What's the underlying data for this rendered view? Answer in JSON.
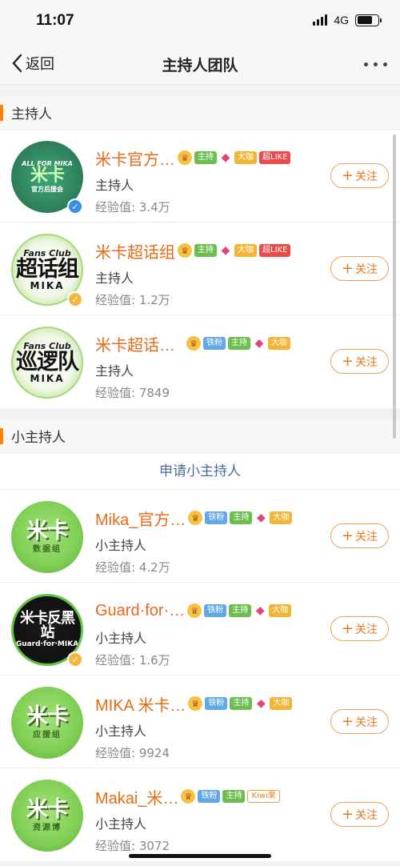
{
  "status": {
    "time": "11:07",
    "network": "4G"
  },
  "nav": {
    "back_label": "返回",
    "title": "主持人团队"
  },
  "sections": {
    "hosts_title": "主持人",
    "sub_hosts_title": "小主持人",
    "apply_label": "申请小主持人"
  },
  "follow_label": "关注",
  "hosts": [
    {
      "name": "米卡官方…",
      "role": "主持人",
      "exp": "经验值: 3.4万",
      "avatar": {
        "line1": "ALL FOR MIKA",
        "line2": "米卡",
        "line3": "官方后援会"
      },
      "tags": [
        "主持",
        "大咖",
        "超LIKE"
      ]
    },
    {
      "name": "米卡超话组",
      "role": "主持人",
      "exp": "经验值: 1.2万",
      "avatar": {
        "line1": "Fans Club",
        "line2": "超话组",
        "line3": "MIKA"
      },
      "tags": [
        "主持",
        "大咖",
        "超LIKE"
      ]
    },
    {
      "name": "米卡超话…",
      "role": "主持人",
      "exp": "经验值: 7849",
      "avatar": {
        "line1": "Fans Club",
        "line2": "巡逻队",
        "line3": "MIKA"
      },
      "tags": [
        "铁粉",
        "主持",
        "大咖"
      ]
    }
  ],
  "sub_hosts": [
    {
      "name": "Mika_官方…",
      "role": "小主持人",
      "exp": "经验值: 4.2万",
      "avatar": {
        "line1": "",
        "line2": "米卡",
        "line3": "数据组"
      },
      "tags": [
        "铁粉",
        "主持",
        "大咖"
      ]
    },
    {
      "name": "Guard·for·…",
      "role": "小主持人",
      "exp": "经验值: 1.6万",
      "avatar": {
        "line1": "",
        "line2": "米卡反黑站",
        "line3": "Guard·for·MIKA"
      },
      "tags": [
        "铁粉",
        "主持",
        "大咖"
      ]
    },
    {
      "name": "MIKA 米卡…",
      "role": "小主持人",
      "exp": "经验值: 9924",
      "avatar": {
        "line1": "",
        "line2": "米卡",
        "line3": "应援组"
      },
      "tags": [
        "铁粉",
        "主持",
        "大咖"
      ]
    },
    {
      "name": "Makai_米…",
      "role": "小主持人",
      "exp": "经验值: 3072",
      "avatar": {
        "line1": "",
        "line2": "米卡",
        "line3": "资源博"
      },
      "tags": [
        "铁粉",
        "主持",
        "Kiwi果"
      ]
    }
  ],
  "colors": {
    "accent": "#ff8200",
    "name": "#e86a15",
    "link": "#4a6d9b"
  }
}
